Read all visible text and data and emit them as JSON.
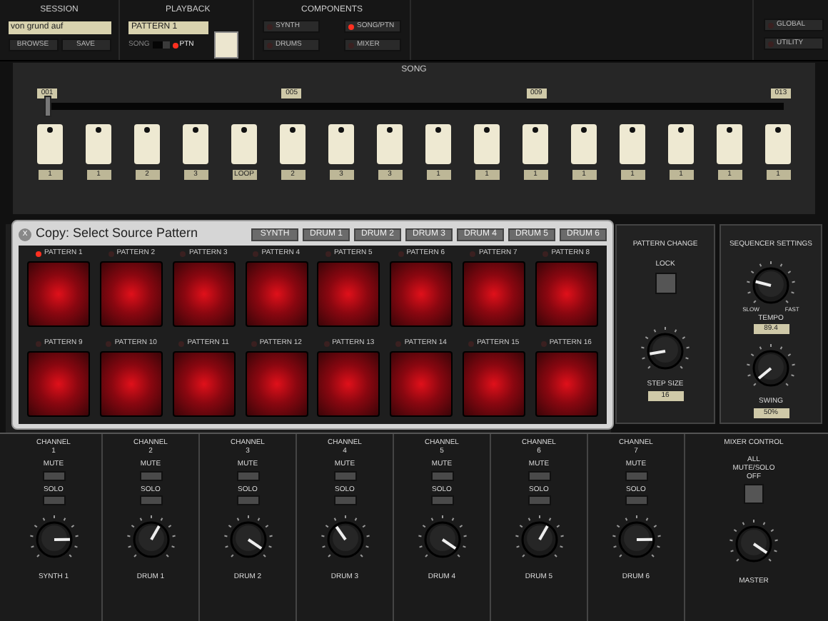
{
  "session": {
    "title": "SESSION",
    "name_field": "von grund auf",
    "buttons": [
      "BROWSE",
      "SAVE"
    ]
  },
  "playback": {
    "title": "PLAYBACK",
    "pattern_field": "PATTERN 1",
    "modes": [
      {
        "label": "SONG",
        "selected": false
      },
      {
        "label": "PTN",
        "selected": true
      }
    ]
  },
  "components": {
    "title": "COMPONENTS",
    "items": [
      {
        "label": "SYNTH",
        "on": false
      },
      {
        "label": "DRUMS",
        "on": false
      },
      {
        "label": "SONG/PTN",
        "on": true
      },
      {
        "label": "MIXER",
        "on": false
      }
    ]
  },
  "utility_buttons": [
    "GLOBAL",
    "UTILITY"
  ],
  "song": {
    "title": "SONG",
    "markers": [
      "001",
      "005",
      "009",
      "013"
    ],
    "position": {
      "level": 0
    },
    "steps": [
      "1",
      "1",
      "2",
      "3",
      "LOOP",
      "2",
      "3",
      "3",
      "1",
      "1",
      "1",
      "1",
      "1",
      "1",
      "1",
      "1"
    ]
  },
  "copy_dialog": {
    "title": "Copy: Select Source Pattern",
    "close": "X",
    "tabs": [
      {
        "label": "SYNTH",
        "selected": false
      },
      {
        "label": "DRUM 1",
        "selected": false
      },
      {
        "label": "DRUM 2",
        "selected": false
      },
      {
        "label": "DRUM 3",
        "selected": false
      },
      {
        "label": "DRUM 4",
        "selected": false
      },
      {
        "label": "DRUM 5",
        "selected": false
      },
      {
        "label": "DRUM 6",
        "selected": false
      }
    ],
    "patterns": [
      {
        "label": "PATTERN 1",
        "selected": true
      },
      {
        "label": "PATTERN 2",
        "selected": false
      },
      {
        "label": "PATTERN 3",
        "selected": false
      },
      {
        "label": "PATTERN 4",
        "selected": false
      },
      {
        "label": "PATTERN 5",
        "selected": false
      },
      {
        "label": "PATTERN 6",
        "selected": false
      },
      {
        "label": "PATTERN 7",
        "selected": false
      },
      {
        "label": "PATTERN 8",
        "selected": false
      },
      {
        "label": "PATTERN 9",
        "selected": false
      },
      {
        "label": "PATTERN 10",
        "selected": false
      },
      {
        "label": "PATTERN 11",
        "selected": false
      },
      {
        "label": "PATTERN 12",
        "selected": false
      },
      {
        "label": "PATTERN 13",
        "selected": false
      },
      {
        "label": "PATTERN 14",
        "selected": false
      },
      {
        "label": "PATTERN 15",
        "selected": false
      },
      {
        "label": "PATTERN 16",
        "selected": false
      }
    ]
  },
  "pattern_change": {
    "title": "PATTERN CHANGE",
    "lock": "LOCK",
    "step_size": {
      "label": "STEP SIZE",
      "value": "16",
      "level": 0.13
    }
  },
  "sequencer_settings": {
    "title": "SEQUENCER SETTINGS",
    "tempo": {
      "min": "SLOW",
      "max": "FAST",
      "label": "TEMPO",
      "value": "89.4",
      "level": 0.22
    },
    "swing": {
      "label": "SWING",
      "value": "50%",
      "level": 0.02
    }
  },
  "mixer": {
    "channels": [
      {
        "title": "CHANNEL",
        "number": "1",
        "mute": "MUTE",
        "solo": "SOLO",
        "name": "SYNTH 1",
        "level": 0.83
      },
      {
        "title": "CHANNEL",
        "number": "2",
        "mute": "MUTE",
        "solo": "SOLO",
        "name": "DRUM 1",
        "level": 0.61
      },
      {
        "title": "CHANNEL",
        "number": "3",
        "mute": "MUTE",
        "solo": "SOLO",
        "name": "DRUM 2",
        "level": 0.96
      },
      {
        "title": "CHANNEL",
        "number": "4",
        "mute": "MUTE",
        "solo": "SOLO",
        "name": "DRUM 3",
        "level": 0.37
      },
      {
        "title": "CHANNEL",
        "number": "5",
        "mute": "MUTE",
        "solo": "SOLO",
        "name": "DRUM 4",
        "level": 0.96
      },
      {
        "title": "CHANNEL",
        "number": "6",
        "mute": "MUTE",
        "solo": "SOLO",
        "name": "DRUM 5",
        "level": 0.61
      },
      {
        "title": "CHANNEL",
        "number": "7",
        "mute": "MUTE",
        "solo": "SOLO",
        "name": "DRUM 6",
        "level": 0.83
      }
    ],
    "control": {
      "title": "MIXER CONTROL",
      "all_off": "ALL MUTE/SOLO OFF",
      "name": "MASTER",
      "level": 0.96
    }
  }
}
